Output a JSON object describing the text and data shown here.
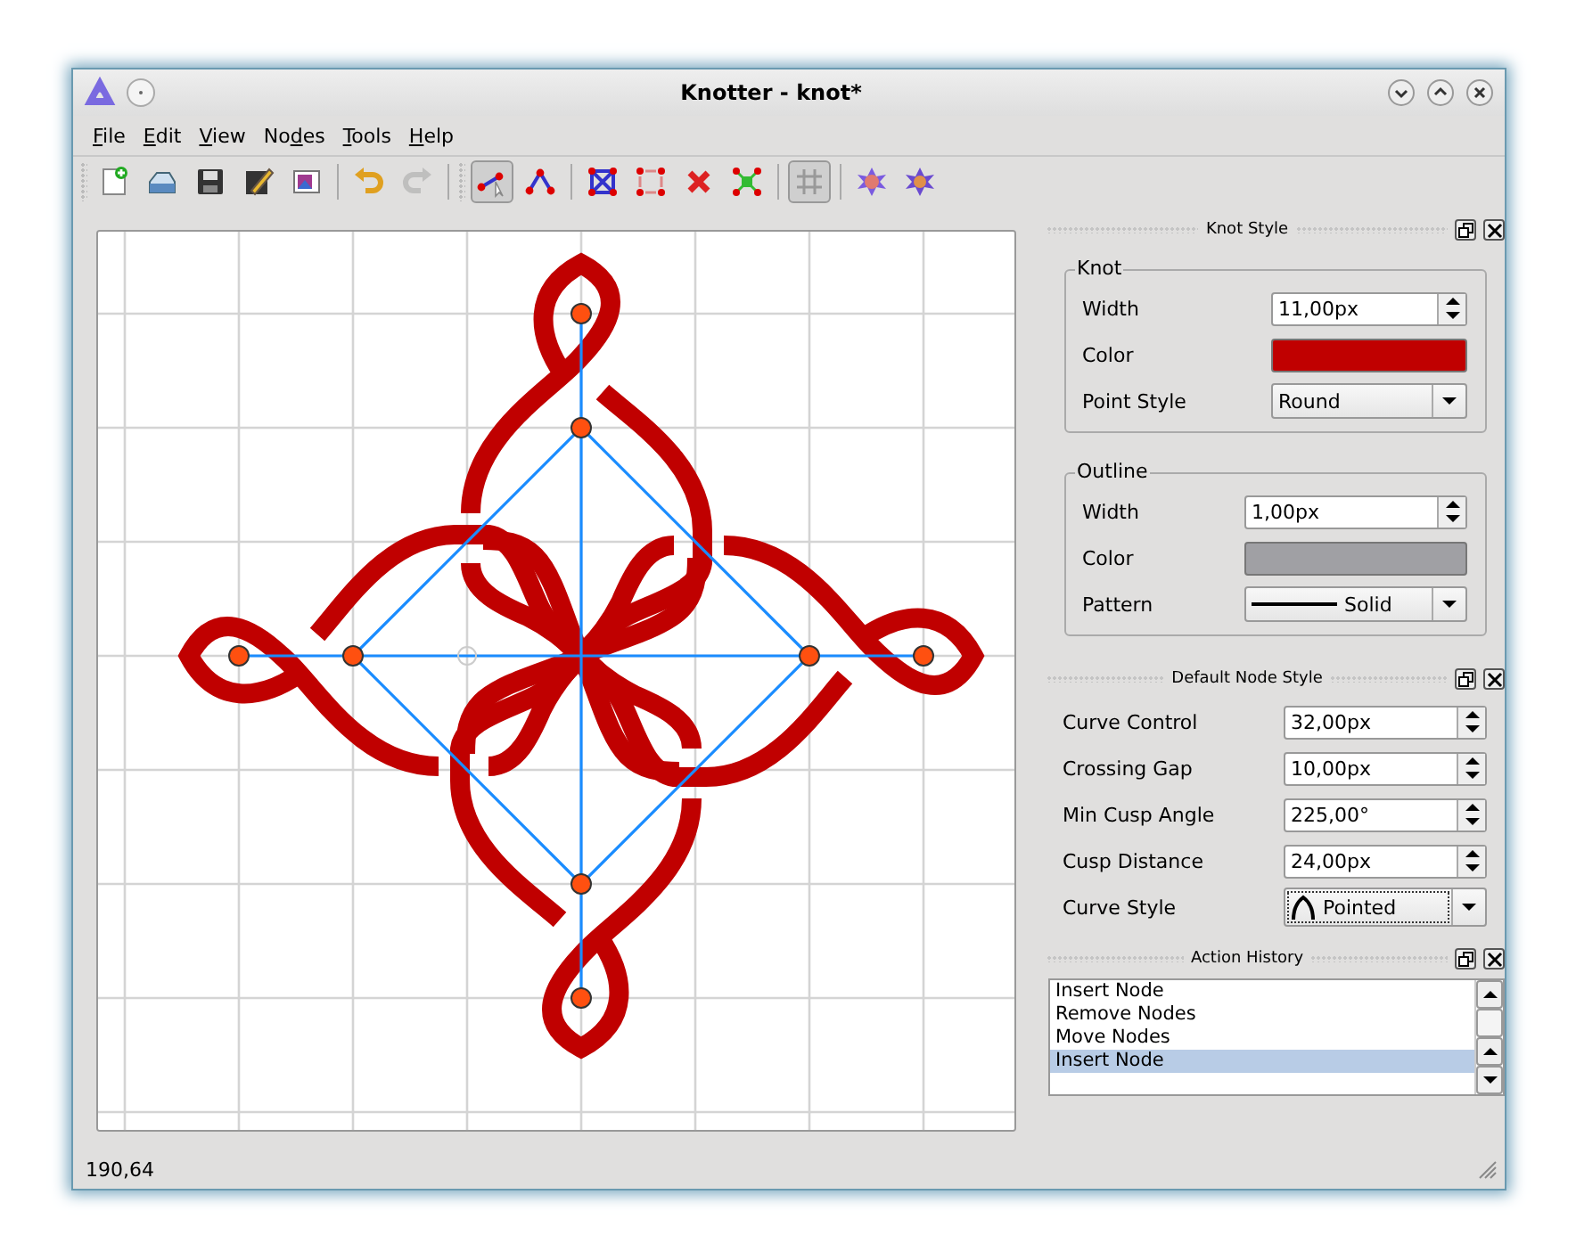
{
  "window": {
    "title": "Knotter - knot*"
  },
  "menu": [
    {
      "key": "F",
      "after": "ile"
    },
    {
      "key": "E",
      "after": "dit"
    },
    {
      "key": "V",
      "after": "iew"
    },
    {
      "before": "No",
      "key": "d",
      "after": "es"
    },
    {
      "key": "T",
      "after": "ools"
    },
    {
      "key": "H",
      "after": "elp"
    }
  ],
  "toolbar": [
    {
      "items": [
        {
          "kind": "new",
          "selected": false,
          "disabled": false
        },
        {
          "kind": "open",
          "selected": false,
          "disabled": false
        },
        {
          "kind": "save",
          "selected": false,
          "disabled": false
        },
        {
          "kind": "edit",
          "selected": false,
          "disabled": false
        },
        {
          "kind": "export",
          "selected": false,
          "disabled": false
        }
      ]
    },
    {
      "items": [
        {
          "kind": "undo",
          "selected": false,
          "disabled": false
        },
        {
          "kind": "redo",
          "selected": false,
          "disabled": true
        }
      ]
    },
    {
      "items": [
        {
          "kind": "edit-mode",
          "selected": true,
          "disabled": false
        },
        {
          "kind": "draw-mode",
          "selected": false,
          "disabled": false
        }
      ]
    },
    {
      "items": [
        {
          "kind": "connect-all",
          "selected": false,
          "disabled": false
        },
        {
          "kind": "link",
          "selected": false,
          "disabled": false
        },
        {
          "kind": "erase",
          "selected": false,
          "disabled": false
        },
        {
          "kind": "merge",
          "selected": false,
          "disabled": false
        }
      ]
    },
    {
      "items": [
        {
          "kind": "grid",
          "selected": true,
          "disabled": false
        }
      ]
    },
    {
      "items": [
        {
          "kind": "star-a",
          "selected": false,
          "disabled": false
        },
        {
          "kind": "star-b",
          "selected": false,
          "disabled": false
        }
      ]
    }
  ],
  "knot_style": {
    "title": "Knot Style",
    "groups": [
      {
        "title": "Knot",
        "rows": [
          {
            "kind": "spin",
            "label": "Width",
            "value": "11,00px"
          },
          {
            "kind": "color",
            "label": "Color",
            "color": "#c00000"
          },
          {
            "kind": "combo",
            "label": "Point Style",
            "value": "Round"
          }
        ]
      },
      {
        "title": "Outline",
        "rows": [
          {
            "kind": "spin",
            "label": "Width",
            "value": "1,00px"
          },
          {
            "kind": "color",
            "label": "Color",
            "color": "#a0a0a4"
          },
          {
            "kind": "line-combo",
            "label": "Pattern",
            "value": "Solid"
          }
        ]
      }
    ]
  },
  "node_style": {
    "title": "Default Node Style",
    "rows": [
      {
        "kind": "spin",
        "label": "Curve Control",
        "value": "32,00px"
      },
      {
        "kind": "spin",
        "label": "Crossing Gap",
        "value": "10,00px"
      },
      {
        "kind": "spin",
        "label": "Min Cusp Angle",
        "value": "225,00°"
      },
      {
        "kind": "spin",
        "label": "Cusp Distance",
        "value": "24,00px"
      },
      {
        "kind": "cusp-combo",
        "label": "Curve Style",
        "value": "Pointed",
        "focused": true
      }
    ]
  },
  "history": {
    "title": "Action History",
    "items": [
      {
        "label": "Insert Node",
        "selected": false
      },
      {
        "label": "Remove Nodes",
        "selected": false
      },
      {
        "label": "Move Nodes",
        "selected": false
      },
      {
        "label": "Insert Node",
        "selected": true
      }
    ]
  },
  "status_bar": {
    "text": "190,64"
  }
}
